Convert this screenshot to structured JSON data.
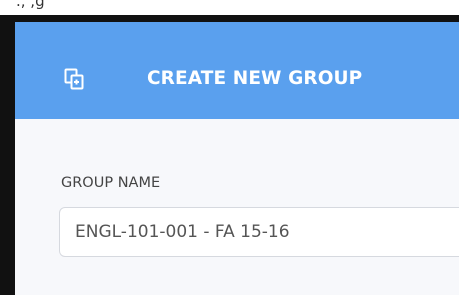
{
  "partial_top_text": "., ,g",
  "dialog": {
    "title": "CREATE NEW GROUP",
    "header_icon": "copy-group-icon",
    "header_color": "#5aa0ee"
  },
  "form": {
    "group_name_label": "GROUP NAME",
    "group_name_value": "ENGL-101-001 - FA 15-16"
  }
}
